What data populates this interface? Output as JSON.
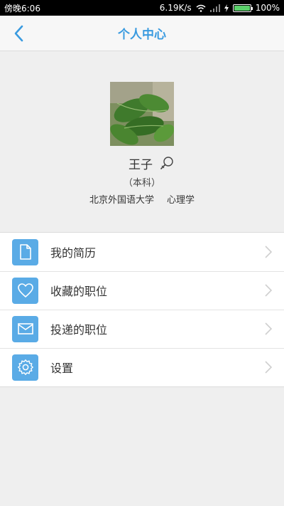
{
  "status_bar": {
    "time": "傍晚6:06",
    "speed": "6.19K/s",
    "battery": "100%",
    "battery_level": 1.0
  },
  "header": {
    "title": "个人中心",
    "back_icon": "back-arrow-icon"
  },
  "profile": {
    "name": "王子",
    "degree": "（本科）",
    "school": "北京外国语大学",
    "major": "心理学",
    "edit_icon": "edit-icon"
  },
  "menu": {
    "items": [
      {
        "label": "我的简历",
        "icon": "document-icon"
      },
      {
        "label": "收藏的职位",
        "icon": "heart-icon"
      },
      {
        "label": "投递的职位",
        "icon": "envelope-icon"
      },
      {
        "label": "设置",
        "icon": "gear-icon"
      }
    ]
  },
  "colors": {
    "accent": "#3a9be0",
    "icon_bg": "#5aabe6",
    "page_bg": "#efefef"
  }
}
